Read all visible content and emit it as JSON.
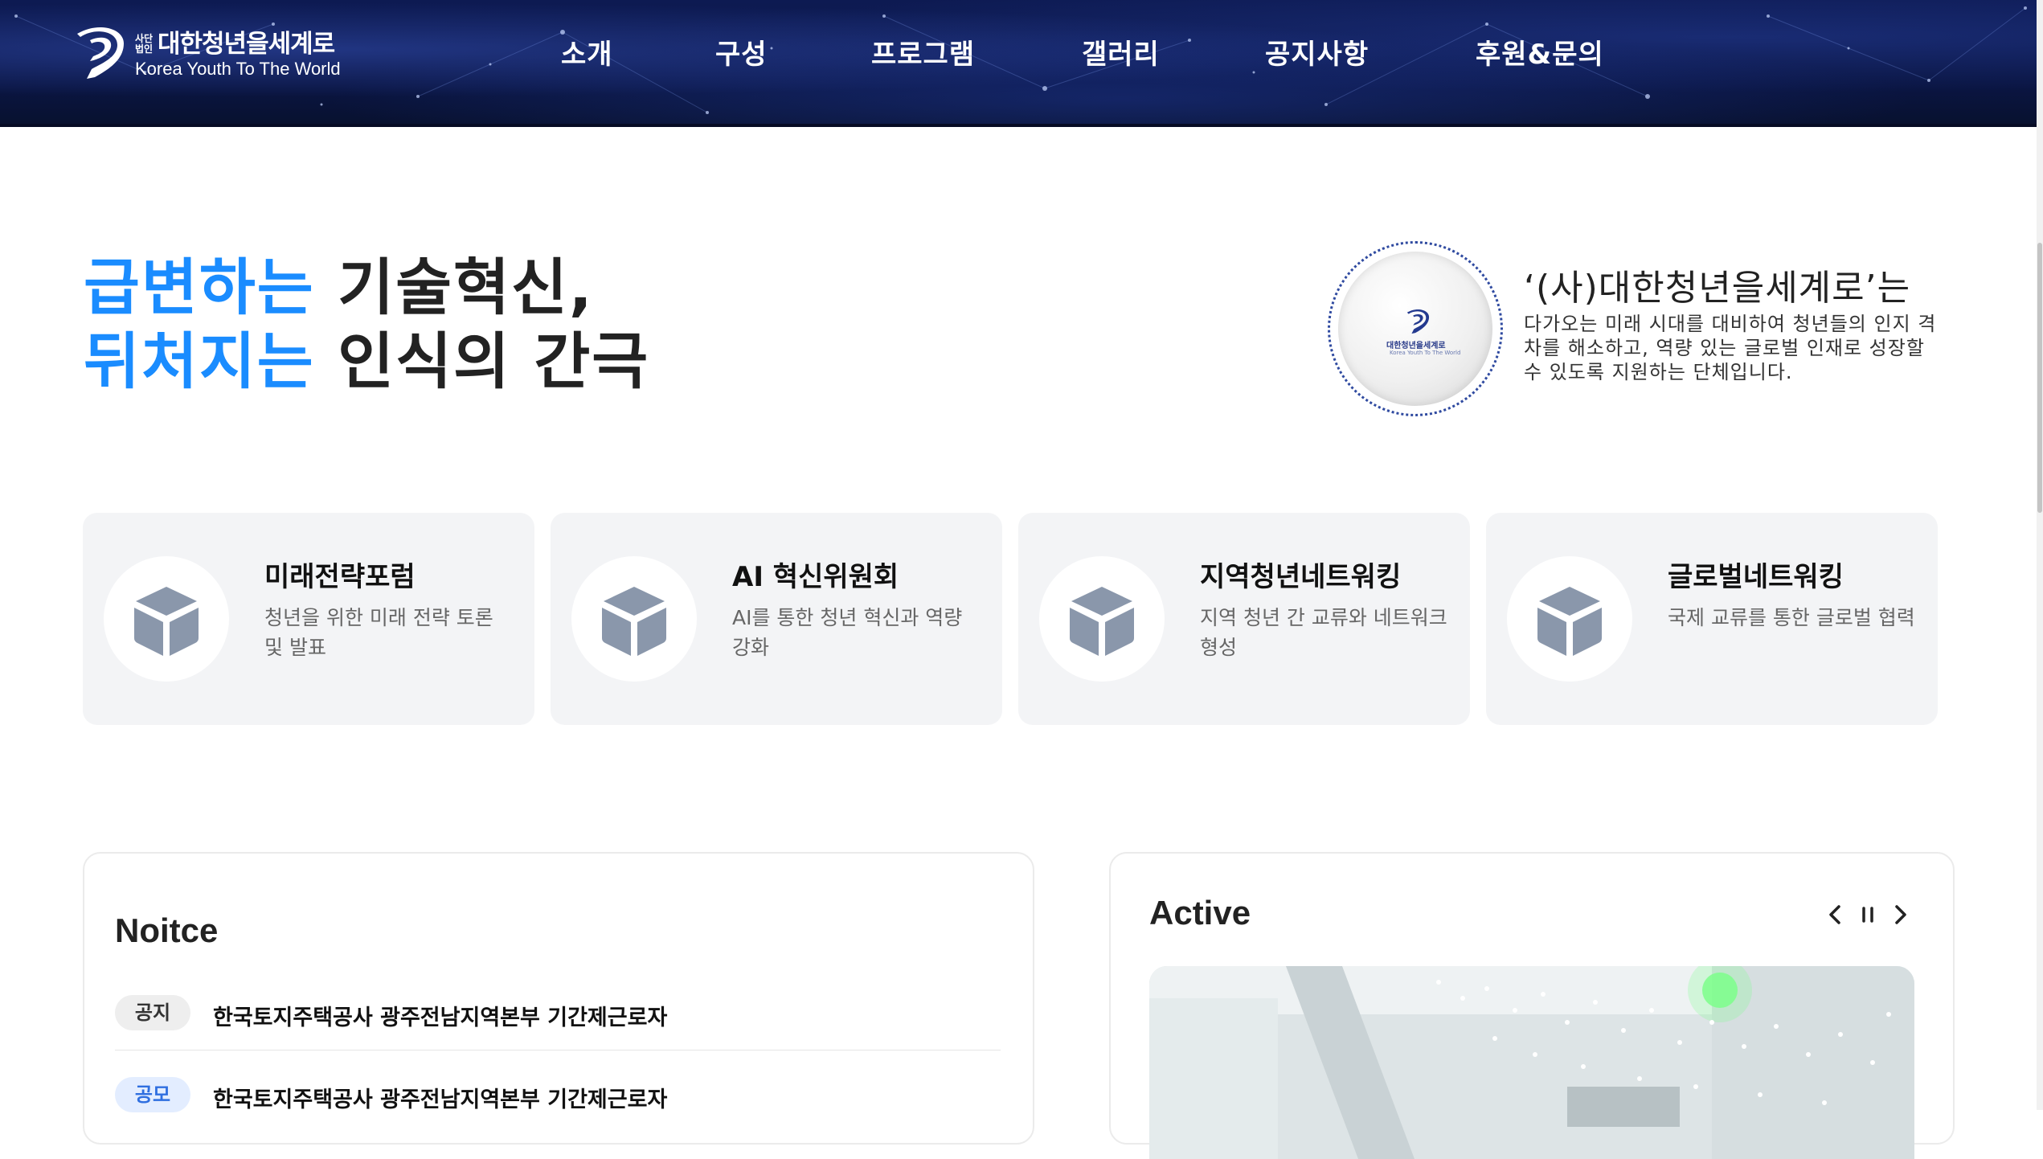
{
  "header": {
    "logo": {
      "corp_line1": "사단",
      "corp_line2": "법인",
      "name": "대한청년을세계로",
      "sub": "Korea Youth To The World"
    },
    "nav": [
      "소개",
      "구성",
      "프로그램",
      "갤러리",
      "공지사항",
      "후원&문의"
    ]
  },
  "hero": {
    "line1_accent": "급변하는",
    "line1_rest": " 기술혁신,",
    "line2_accent": "뒤처지는",
    "line2_rest": " 인식의 간극",
    "accent_color": "#1a8cff"
  },
  "intro": {
    "badge_name": "대한청년을세계로",
    "badge_sub": "Korea Youth To The World",
    "title": "‘(사)대한청년을세계로’는",
    "description": "다가오는 미래 시대를 대비하여 청년들의 인지 격차를 해소하고, 역량 있는 글로벌 인재로 성장할 수 있도록 지원하는 단체입니다."
  },
  "cards": [
    {
      "title": "미래전략포럼",
      "desc": "청년을 위한 미래 전략 토론 및 발표",
      "icon": "cube-icon"
    },
    {
      "title": "AI 혁신위원회",
      "desc": "AI를 통한 청년 혁신과 역량 강화",
      "icon": "cube-icon"
    },
    {
      "title": "지역청년네트워킹",
      "desc": "지역 청년 간 교류와 네트워크 형성",
      "icon": "cube-icon"
    },
    {
      "title": "글로벌네트워킹",
      "desc": "국제 교류를 통한 글로벌 협력",
      "icon": "cube-icon"
    }
  ],
  "notice": {
    "title": "Noitce",
    "items": [
      {
        "badge": "공지",
        "text": "한국토지주택공사 광주전남지역본부 기간제근로자"
      },
      {
        "badge": "공모",
        "text": "한국토지주택공사 광주전남지역본부 기간제근로자"
      }
    ]
  },
  "active": {
    "title": "Active",
    "controls": [
      "chevron-left-icon",
      "pause-icon",
      "chevron-right-icon"
    ]
  },
  "colors": {
    "header_bg": "#0d1a52",
    "accent": "#1a8cff",
    "card_bg": "#f3f4f6",
    "icon_gray": "#8a97ab"
  }
}
